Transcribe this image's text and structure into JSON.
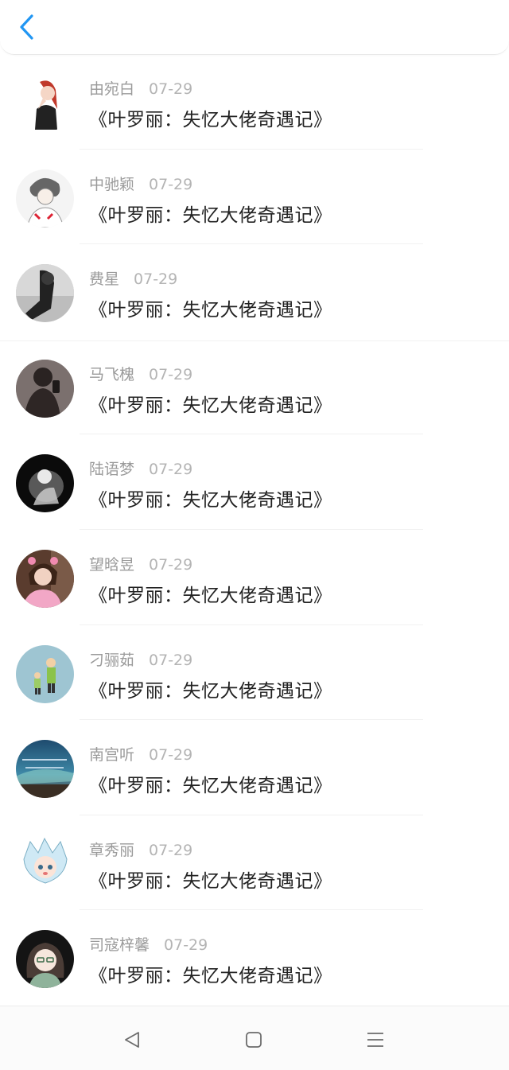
{
  "header": {
    "back_icon": "chevron-left-icon",
    "accent": "#2196f3"
  },
  "feed": {
    "items": [
      {
        "name": "由宛白",
        "date": "07-29",
        "title": "《叶罗丽：失忆大佬奇遇记》"
      },
      {
        "name": "中驰颖",
        "date": "07-29",
        "title": "《叶罗丽：失忆大佬奇遇记》"
      },
      {
        "name": "费星",
        "date": "07-29",
        "title": "《叶罗丽：失忆大佬奇遇记》"
      },
      {
        "name": "马飞槐",
        "date": "07-29",
        "title": "《叶罗丽：失忆大佬奇遇记》"
      },
      {
        "name": "陆语梦",
        "date": "07-29",
        "title": "《叶罗丽：失忆大佬奇遇记》"
      },
      {
        "name": "望晗昱",
        "date": "07-29",
        "title": "《叶罗丽：失忆大佬奇遇记》"
      },
      {
        "name": "刁骊茹",
        "date": "07-29",
        "title": "《叶罗丽：失忆大佬奇遇记》"
      },
      {
        "name": "南宫听",
        "date": "07-29",
        "title": "《叶罗丽：失忆大佬奇遇记》"
      },
      {
        "name": "章秀丽",
        "date": "07-29",
        "title": "《叶罗丽：失忆大佬奇遇记》"
      },
      {
        "name": "司寇梓馨",
        "date": "07-29",
        "title": "《叶罗丽：失忆大佬奇遇记》"
      }
    ]
  },
  "navbar": {
    "back_icon": "triangle-back-icon",
    "home_icon": "square-home-icon",
    "menu_icon": "hamburger-menu-icon"
  }
}
